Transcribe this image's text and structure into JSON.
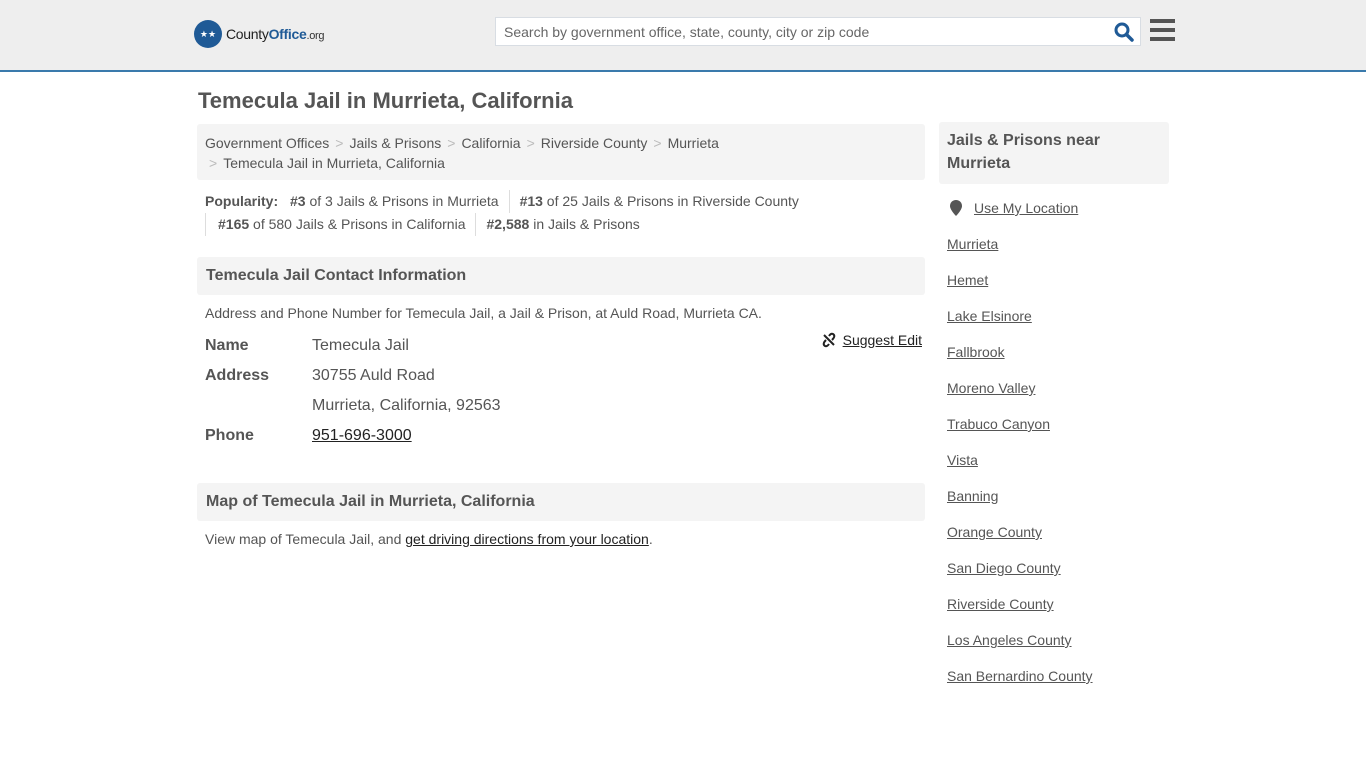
{
  "header": {
    "logo_main": "County",
    "logo_bold": "Office",
    "logo_tld": ".org",
    "search_placeholder": "Search by government office, state, county, city or zip code",
    "icons": {
      "search": "search-icon",
      "menu": "hamburger-menu-icon",
      "logo": "eagle-logo-icon"
    }
  },
  "page_title": "Temecula Jail in Murrieta, California",
  "breadcrumb": [
    "Government Offices",
    "Jails & Prisons",
    "California",
    "Riverside County",
    "Murrieta",
    "Temecula Jail in Murrieta, California"
  ],
  "popularity": {
    "label": "Popularity:",
    "items": [
      {
        "rank": "#3",
        "text": " of 3 Jails & Prisons in Murrieta"
      },
      {
        "rank": "#13",
        "text": " of 25 Jails & Prisons in Riverside County"
      },
      {
        "rank": "#165",
        "text": " of 580 Jails & Prisons in California"
      },
      {
        "rank": "#2,588",
        "text": " in Jails & Prisons"
      }
    ]
  },
  "contact": {
    "heading": "Temecula Jail Contact Information",
    "description": "Address and Phone Number for Temecula Jail, a Jail & Prison, at Auld Road, Murrieta CA.",
    "suggest_edit": "Suggest Edit",
    "name_label": "Name",
    "name": "Temecula Jail",
    "address_label": "Address",
    "address_line1": "30755 Auld Road",
    "address_line2": "Murrieta, California, 92563",
    "phone_label": "Phone",
    "phone": "951-696-3000"
  },
  "map": {
    "heading": "Map of Temecula Jail in Murrieta, California",
    "text_before": "View map of Temecula Jail, and ",
    "link": "get driving directions from your location",
    "text_after": "."
  },
  "sidebar": {
    "heading": "Jails & Prisons near Murrieta",
    "use_location": "Use My Location",
    "links": [
      "Murrieta",
      "Hemet",
      "Lake Elsinore",
      "Fallbrook",
      "Moreno Valley",
      "Trabuco Canyon",
      "Vista",
      "Banning",
      "Orange County",
      "San Diego County",
      "Riverside County",
      "Los Angeles County",
      "San Bernardino County"
    ]
  }
}
